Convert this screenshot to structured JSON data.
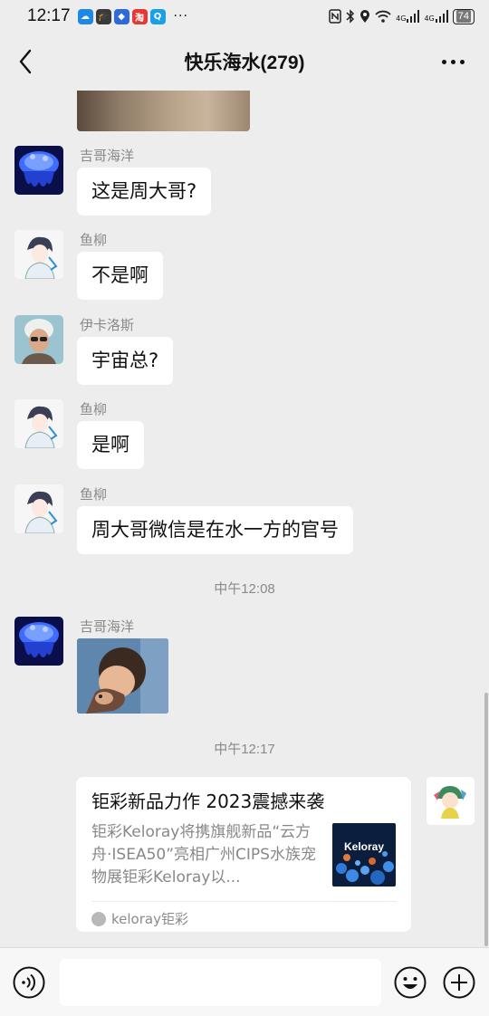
{
  "status_bar": {
    "time": "12:17",
    "more": "···",
    "network_1": "4G",
    "network_2": "4G",
    "battery": "74"
  },
  "header": {
    "title": "快乐海水(279)"
  },
  "messages": [
    {
      "sender": "吉哥海洋",
      "text": "这是周大哥?"
    },
    {
      "sender": "鱼柳",
      "text": "不是啊"
    },
    {
      "sender": "伊卡洛斯",
      "text": "宇宙总?"
    },
    {
      "sender": "鱼柳",
      "text": "是啊"
    },
    {
      "sender": "鱼柳",
      "text": "周大哥微信是在水一方的官号"
    },
    {
      "sender": "吉哥海洋"
    }
  ],
  "timestamps": [
    "中午12:08",
    "中午12:17"
  ],
  "card": {
    "title": "钜彩新品力作 2023震撼来袭",
    "description": "钜彩Keloray将携旗舰新品“云方舟·ISEA50”亮相广州CIPS水族宠物展钜彩Keloray以...",
    "thumb_text": "Keloray",
    "source": "keloray钜彩"
  },
  "input": {
    "placeholder": ""
  },
  "colors": {
    "background": "#ededed",
    "bubble": "#ffffff",
    "meta_text": "#8a8a8a"
  }
}
